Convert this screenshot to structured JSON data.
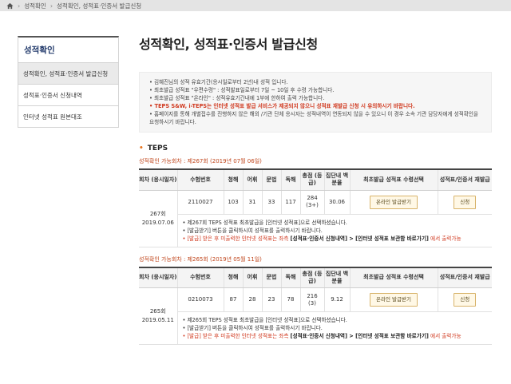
{
  "breadcrumb": {
    "items": [
      "성적확인",
      "성적확인, 성적표·인증서 발급신청"
    ]
  },
  "sidebar": {
    "title": "성적확인",
    "items": [
      {
        "label": "성적확인, 성적표·인증서 발급신청"
      },
      {
        "label": "성적표·인증서 신청내역"
      },
      {
        "label": "인터넷 성적표 원본대조"
      }
    ]
  },
  "page": {
    "title": "성적확인, 성적표·인증서 발급신청"
  },
  "notice": {
    "lines": [
      "• 김혜진님의 성적 유효기간(응시일로부터 2년)내 성적 입니다.",
      "• 최초발급 성적표 \"우편수령\" : 성적발표일로부터 7일 ~ 10일 후 수령 가능합니다.",
      "• 최초발급 성적표 \"온라인\" : 성적유효기간내에 1부에 한하여 출력 가능합니다."
    ],
    "red_line": "• TEPS S&W, i-TEPS는 인터넷 성적표 발급 서비스가 제공되지 않으니 성적표 재발급 신청 시 유의하시기 바랍니다.",
    "last_line": "• 홈페이지를 통해 개별접수를 진행하지 않은 해외 /기관 단체 응시자는 성적내역이 연동되지 않을 수 있으니 이 경우 소속 기관 담당자에게 성적확인을 요청하시기 바랍니다."
  },
  "section": {
    "title": "TEPS"
  },
  "table_headers": {
    "round": "회차 (응시일자)",
    "exam_no": "수험번호",
    "listening": "청해",
    "vocab": "어휘",
    "grammar": "문법",
    "reading": "독해",
    "total": "총점 (등급)",
    "percentile": "집단내 백분율",
    "first_issue": "최초발급 성적표 수령선택",
    "reissue": "성적표/인증서 재발급"
  },
  "sessions": [
    {
      "label": "성적확인 가능회차 : 제267회 (2019년 07월 06일)",
      "round": "267회",
      "date": "2019.07.06",
      "exam_no": "2110027",
      "listening": "103",
      "vocab": "31",
      "grammar": "33",
      "reading": "117",
      "total": "284",
      "grade": "(3+)",
      "percentile": "30.06",
      "online_btn": "온라인 발급받기",
      "reissue_btn": "신청",
      "note1": "• 제267회 TEPS 성적표 최초발급을 [인터넷 성적표]으로 선택하셨습니다.",
      "note2": "• [발급받기] 버튼을 클릭하시여 성적표를 출력하시기 바랍니다.",
      "note3_red": "• [발급] 받은 후 미출력한 인터넷 성적표는 좌측",
      "note3_bold": "[성적표·인증서 신청내역] > [인터넷 성적표 보관함 바로가기]",
      "note3_end": "에서 출력가능"
    },
    {
      "label": "성적확인 가능회차 : 제265회 (2019년 05월 11일)",
      "round": "265회",
      "date": "2019.05.11",
      "exam_no": "0210073",
      "listening": "87",
      "vocab": "28",
      "grammar": "23",
      "reading": "78",
      "total": "216",
      "grade": "(3)",
      "percentile": "9.12",
      "online_btn": "온라인 발급받기",
      "reissue_btn": "신청",
      "note1": "• 제265회 TEPS 성적표 최초발급을 [인터넷 성적표]으로 선택하셨습니다.",
      "note2": "• [발급받기] 버튼을 클릭하시여 성적표를 출력하시기 바랍니다.",
      "note3_red": "• [발급] 받은 후 미출력한 인터넷 성적표는 좌측",
      "note3_bold": "[성적표·인증서 신청내역] > [인터넷 성적표 보관함 바로가기]",
      "note3_end": "에서 출력가능"
    }
  ],
  "colors": {
    "accent": "#e87722",
    "red": "#d0381e",
    "title": "#223a6b"
  }
}
